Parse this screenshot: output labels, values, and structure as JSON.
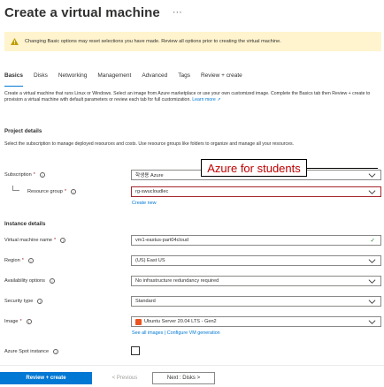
{
  "header": {
    "title": "Create a virtual machine",
    "more": "···"
  },
  "banner": {
    "text": "Changing Basic options may reset selections you have made. Review all options prior to creating the virtual machine."
  },
  "tabs": [
    {
      "label": "Basics",
      "active": true
    },
    {
      "label": "Disks"
    },
    {
      "label": "Networking"
    },
    {
      "label": "Management"
    },
    {
      "label": "Advanced"
    },
    {
      "label": "Tags"
    },
    {
      "label": "Review + create"
    }
  ],
  "intro": {
    "text": "Create a virtual machine that runs Linux or Windows. Select an image from Azure marketplace or use your own customized image. Complete the Basics tab then Review + create to provision a virtual machine with default parameters or review each tab for full customization.",
    "link": "Learn more ↗"
  },
  "project": {
    "heading": "Project details",
    "desc": "Select the subscription to manage deployed resources and costs. Use resource groups like folders to organize and manage all your resources.",
    "subscription_label": "Subscription",
    "subscription_value": "학생용 Azure",
    "rg_label": "Resource group",
    "rg_value": "rg-swucloudlec",
    "create_new": "Create new"
  },
  "instance": {
    "heading": "Instance details",
    "vm_name_label": "Virtual machine name",
    "vm_name_value": "vm1-eastus-part04cloud",
    "region_label": "Region",
    "region_value": "(US) East US",
    "availability_label": "Availability options",
    "availability_value": "No infrastructure redundancy required",
    "security_label": "Security type",
    "security_value": "Standard",
    "image_label": "Image",
    "image_value": "Ubuntu Server 20.04 LTS - Gen2",
    "image_links": "See all images | Configure VM generation",
    "spot_label": "Azure Spot instance"
  },
  "annotation": {
    "text": "Azure for students"
  },
  "footer": {
    "review": "Review + create",
    "previous": "< Previous",
    "next": "Next : Disks >"
  },
  "colors": {
    "accent": "#0078d4",
    "warning_bg": "#fff4ce",
    "required": "#a4262c",
    "annotation": "#c00000"
  },
  "icons": {
    "warning": "warning-icon",
    "info": "info-icon",
    "chevron": "chevron-down-icon",
    "check": "checkmark-icon",
    "ubuntu": "ubuntu-icon"
  }
}
